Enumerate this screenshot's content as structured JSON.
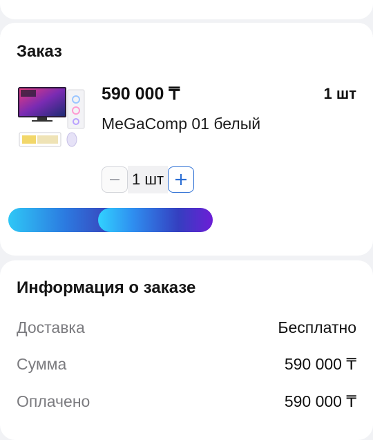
{
  "order": {
    "title": "Заказ",
    "item": {
      "price": "590 000 ₸",
      "quantity_label": "1 шт",
      "name": "MeGaComp 01 белый",
      "image_alt": "computer-set-product-image"
    },
    "stepper": {
      "minus_label": "−",
      "value": "1 шт",
      "plus_label": "+"
    }
  },
  "info": {
    "title": "Информация о заказе",
    "rows": [
      {
        "label": "Доставка",
        "value": "Бесплатно"
      },
      {
        "label": "Сумма",
        "value": "590 000 ₸"
      },
      {
        "label": "Оплачено",
        "value": "590 000 ₸"
      }
    ]
  },
  "colors": {
    "accent": "#2b6ed4",
    "banner_start": "#31d2ff",
    "banner_end": "#6c1ed6"
  }
}
